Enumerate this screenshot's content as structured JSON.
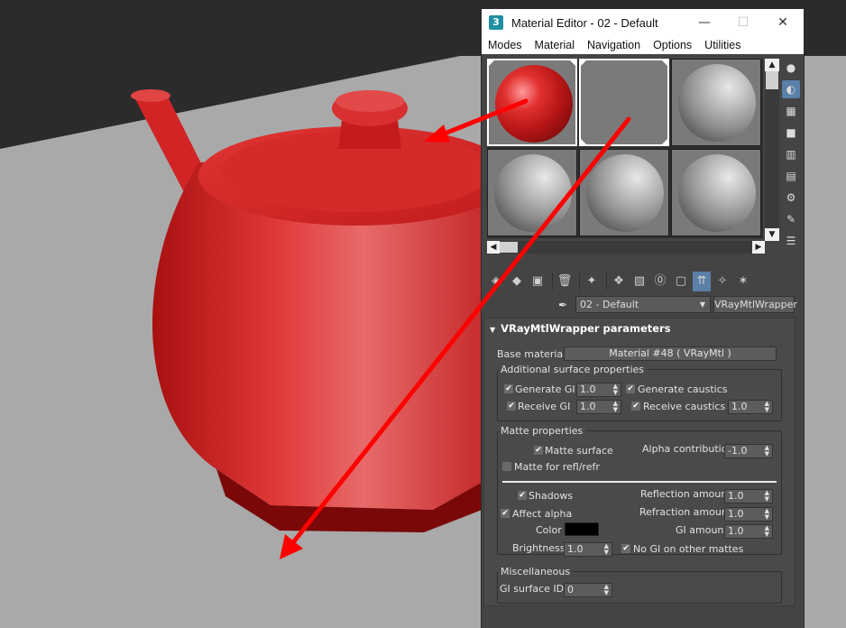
{
  "window": {
    "app_icon": "3",
    "title": "Material Editor - 02 - Default",
    "minimize": "—",
    "maximize": "☐",
    "close": "✕"
  },
  "menu": [
    "Modes",
    "Material",
    "Navigation",
    "Options",
    "Utilities"
  ],
  "material": {
    "name": "02 - Default",
    "type": "VRayMtlWrapper"
  },
  "rollout": {
    "title": "VRayMtlWrapper parameters",
    "base_material_label": "Base material:",
    "base_material_value": "Material #48  ( VRayMtl )",
    "additional": {
      "title": "Additional surface properties",
      "generate_gi_label": "Generate GI",
      "generate_gi_value": "1.0",
      "generate_caustics_label": "Generate caustics",
      "receive_gi_label": "Receive GI",
      "receive_gi_value": "1.0",
      "receive_caustics_label": "Receive caustics",
      "receive_caustics_value": "1.0"
    },
    "matte": {
      "title": "Matte properties",
      "matte_surface_label": "Matte surface",
      "alpha_contribution_label": "Alpha contribution",
      "alpha_contribution_value": "-1.0",
      "matte_refl_label": "Matte for refl/refr",
      "shadows_label": "Shadows",
      "reflection_amount_label": "Reflection amount",
      "reflection_amount_value": "1.0",
      "affect_alpha_label": "Affect alpha",
      "refraction_amount_label": "Refraction amount",
      "refraction_amount_value": "1.0",
      "color_label": "Color",
      "color_value": "#000000",
      "gi_amount_label": "GI amount",
      "gi_amount_value": "1.0",
      "brightness_label": "Brightness",
      "brightness_value": "1.0",
      "no_gi_label": "No GI on other mattes"
    },
    "misc": {
      "title": "Miscellaneous",
      "gi_surface_id_label": "GI surface ID",
      "gi_surface_id_value": "0"
    }
  },
  "colors": {
    "teapot": "#d41f1f",
    "annotation_arrow": "#ff0000",
    "active_tool": "#5a7fa8"
  }
}
